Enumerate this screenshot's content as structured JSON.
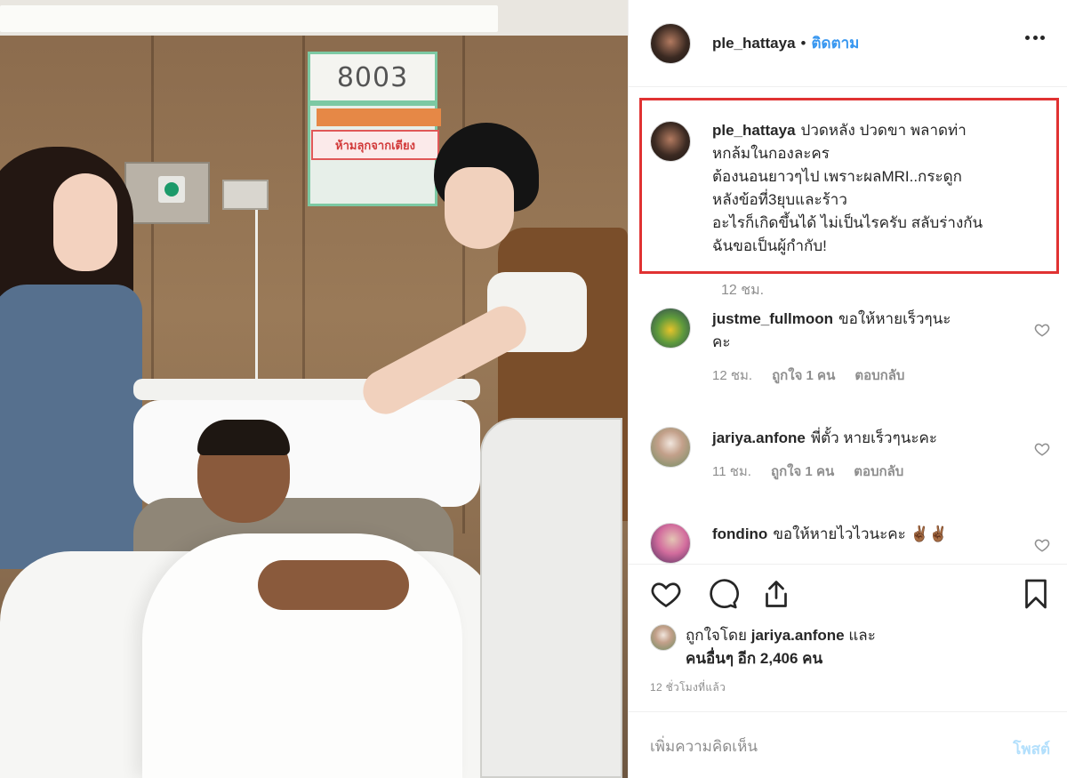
{
  "photo": {
    "room_number": "8003",
    "sign_text": "ห้ามลุกจากเตียง"
  },
  "header": {
    "username": "ple_hattaya",
    "separator": "•",
    "follow_label": "ติดตาม",
    "more_icon": "more-horizontal-icon"
  },
  "caption": {
    "username": "ple_hattaya",
    "lines": [
      "ปวดหลัง ปวดขา พลาดท่า",
      "หกล้มในกองละคร",
      "ต้องนอนยาวๆไป เพราะผลMRI..กระดูก",
      "หลังข้อที่3ยุบและร้าว",
      "อะไรก็เกิดขึ้นได้ ไม่เป็นไรครับ สลับร่างกัน",
      "ฉันขอเป็นผู้กำกับ!"
    ],
    "time": "12 ชม.",
    "highlight_color": "#e03232"
  },
  "comments": [
    {
      "username": "justme_fullmoon",
      "text": "ขอให้หายเร็วๆนะ",
      "text2": "คะ",
      "time": "12 ชม.",
      "likes": "ถูกใจ 1 คน",
      "reply": "ตอบกลับ"
    },
    {
      "username": "jariya.anfone",
      "text": "พี่ตั้ว หายเร็วๆนะคะ",
      "time": "11 ชม.",
      "likes": "ถูกใจ 1 คน",
      "reply": "ตอบกลับ"
    },
    {
      "username": "fondino",
      "text": "ขอให้หายไวไวนะคะ ✌🏾✌🏾"
    }
  ],
  "likes": {
    "prefix": "ถูกใจโดย",
    "user": "jariya.anfone",
    "and": "และ",
    "others": "คนอื่นๆ อีก 2,406 คน"
  },
  "post_time": "12 ชั่วโมงที่แล้ว",
  "add_comment": {
    "placeholder": "เพิ่มความคิดเห็น",
    "post_label": "โพสต์"
  },
  "colors": {
    "link": "#3897f0",
    "muted": "#8e8e8e",
    "post_disabled": "#b2dffc"
  }
}
